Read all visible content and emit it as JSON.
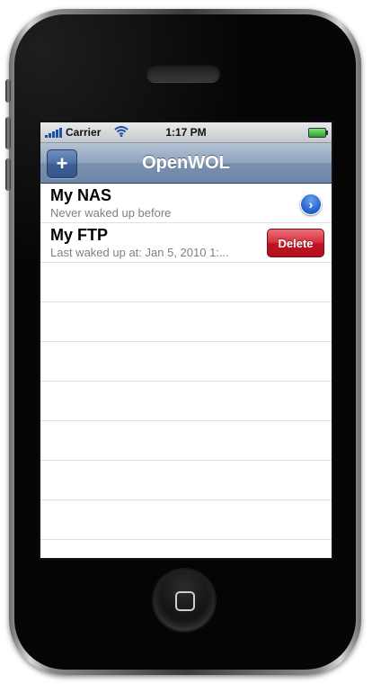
{
  "status_bar": {
    "carrier": "Carrier",
    "time": "1:17 PM",
    "wifi_icon": "wifi-icon",
    "battery_icon": "battery-icon",
    "signal_icon": "signal-bars-icon"
  },
  "nav_bar": {
    "title": "OpenWOL",
    "add_label": "+"
  },
  "hosts": [
    {
      "name": "My NAS",
      "subtitle": "Never waked up before",
      "accessory": "disclosure-button-icon",
      "accessory_glyph": "›"
    },
    {
      "name": "My FTP",
      "subtitle": "Last waked up at: Jan 5, 2010 1:...",
      "delete_label": "Delete"
    }
  ],
  "colors": {
    "nav_bar": "#7991af",
    "delete_red": "#c01422",
    "disclosure_blue": "#1f5ecb"
  }
}
